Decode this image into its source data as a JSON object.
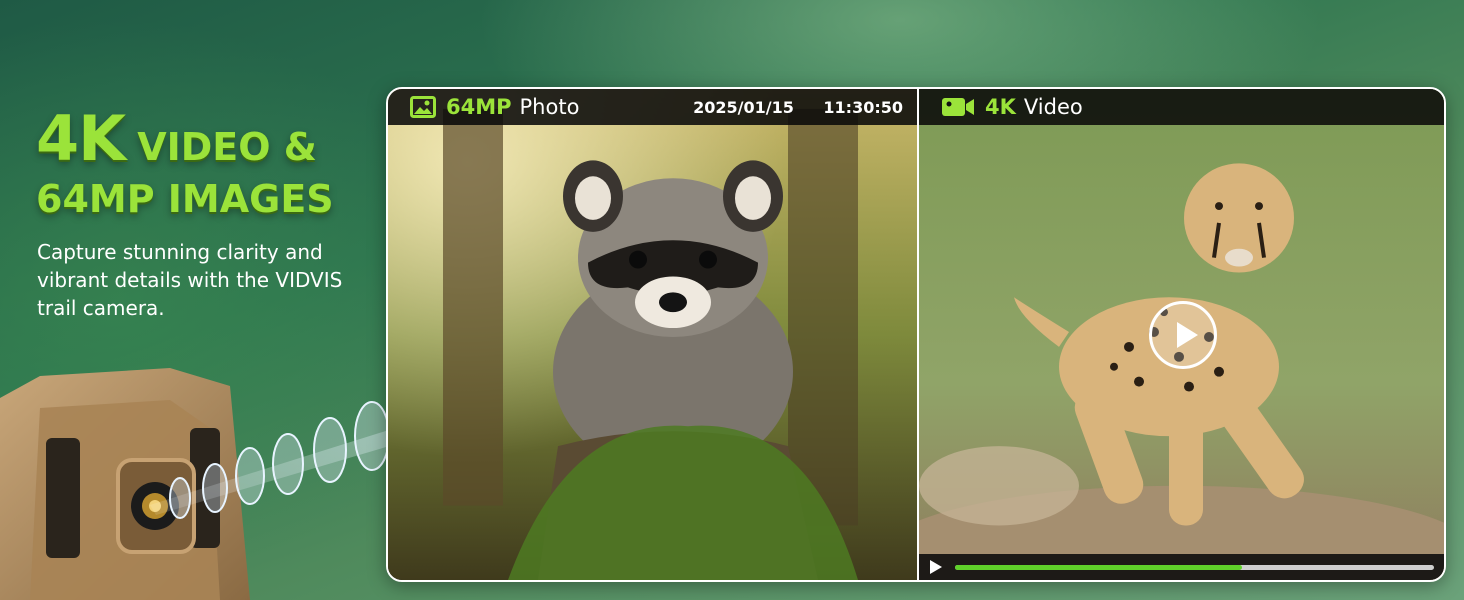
{
  "headline": {
    "line1_big": "4K",
    "line1_small": "VIDEO &",
    "line2": "64MP IMAGES",
    "subtitle": "Capture stunning clarity and vibrant details with the VIDVIS trail camera."
  },
  "photo_panel": {
    "label_accent": "64MP",
    "label": "Photo",
    "date": "2025/01/15",
    "time": "11:30:50",
    "icon": "image-icon"
  },
  "video_panel": {
    "label_accent": "4K",
    "label": "Video",
    "icon": "video-camera-icon",
    "progress": 0.6
  },
  "colors": {
    "accent": "#9be33a",
    "progress": "#5fd12a",
    "bar": "#0a0a0a"
  }
}
